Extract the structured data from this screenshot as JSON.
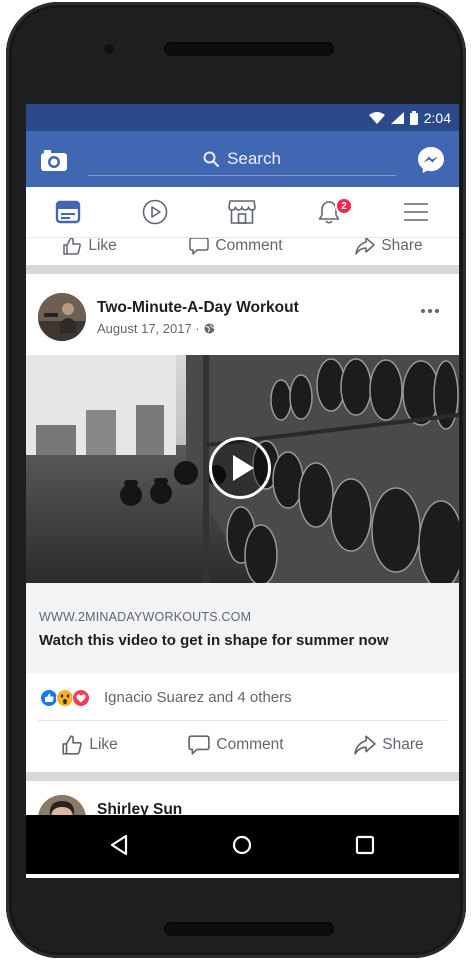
{
  "status_bar": {
    "time": "2:04"
  },
  "header": {
    "search_placeholder": "Search"
  },
  "tabs": [
    {
      "name": "news-feed",
      "icon": "news-feed-icon",
      "active": true
    },
    {
      "name": "watch",
      "icon": "play-circle-icon"
    },
    {
      "name": "marketplace",
      "icon": "storefront-icon"
    },
    {
      "name": "notifications",
      "icon": "bell-icon",
      "badge": "2"
    },
    {
      "name": "menu",
      "icon": "hamburger-icon"
    }
  ],
  "previous_post_actions": {
    "like": "Like",
    "comment": "Comment",
    "share": "Share"
  },
  "post": {
    "page_name": "Two-Minute-A-Day Workout",
    "date": "August 17, 2017 ·",
    "privacy_icon": "globe-icon",
    "link_domain": "WWW.2MINADAYWORKOUTS.COM",
    "link_title": "Watch this video to get in shape for summer now",
    "reactions_text": "Ignacio Suarez and 4 others",
    "reaction_icons": [
      "like-reaction-icon",
      "wow-reaction-icon",
      "love-reaction-icon"
    ],
    "actions": {
      "like": "Like",
      "comment": "Comment",
      "share": "Share"
    }
  },
  "next_post": {
    "author": "Shirley Sun"
  },
  "colors": {
    "brand": "#4267b2",
    "status_bar": "#2b4a8b",
    "badge": "#f02849",
    "link_bg": "#f2f3f5"
  }
}
